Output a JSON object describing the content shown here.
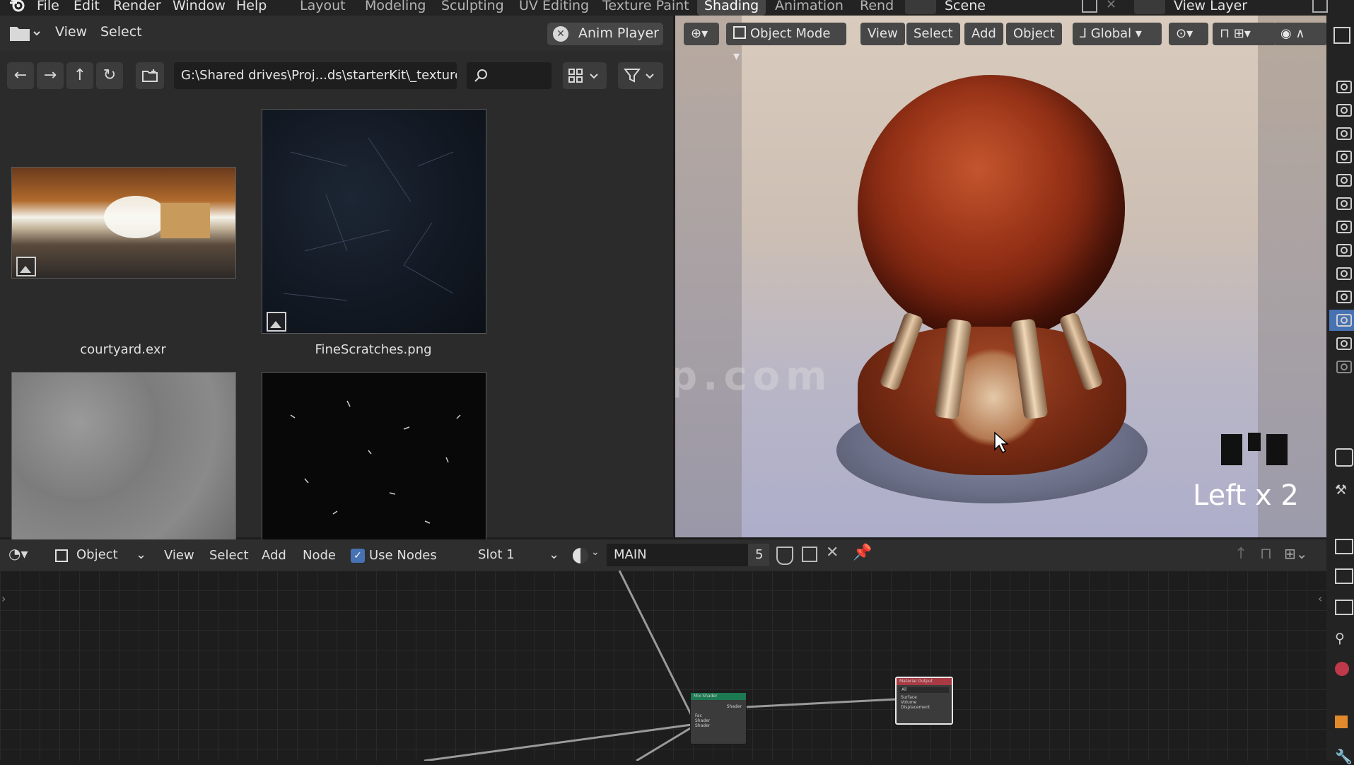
{
  "topbar": {
    "menu": [
      "File",
      "Edit",
      "Render",
      "Window",
      "Help"
    ],
    "workspaces": [
      "Layout",
      "Modeling",
      "Sculpting",
      "UV Editing",
      "Texture Paint",
      "Shading",
      "Animation",
      "Rend"
    ],
    "active_workspace": "Shading",
    "scene": "Scene",
    "view_layer": "View Layer"
  },
  "file_browser": {
    "menu": [
      "View",
      "Select"
    ],
    "anim_player": "Anim Player",
    "path": "G:\\Shared drives\\Proj...ds\\starterKit\\_textures\\",
    "search_placeholder": "",
    "files": [
      {
        "name": "courtyard.exr"
      },
      {
        "name": "FineScratches.png"
      },
      {
        "name": ""
      },
      {
        "name": ""
      }
    ]
  },
  "viewport": {
    "mode": "Object Mode",
    "menu": [
      "View",
      "Select",
      "Add",
      "Object"
    ],
    "transform": "Global",
    "overlay_text": "Left x 2",
    "watermark": "cgsop.com"
  },
  "node_editor": {
    "object": "Object",
    "menu": [
      "View",
      "Select",
      "Add",
      "Node"
    ],
    "use_nodes_label": "Use Nodes",
    "use_nodes_checked": true,
    "slot": "Slot 1",
    "material": "MAIN",
    "user_count": "5",
    "nodes": {
      "mix_shader": {
        "title": "Mix Shader",
        "output": "Shader",
        "inputs": [
          "Fac",
          "Shader",
          "Shader"
        ]
      },
      "material_output": {
        "title": "Material Output",
        "target": "All",
        "inputs": [
          "Surface",
          "Volume",
          "Displacement"
        ]
      }
    }
  },
  "colors": {
    "accent_blue": "#4772b3",
    "header_bg": "#2e2e2e",
    "node_green": "#1c7a52",
    "node_red": "#a83a43"
  }
}
